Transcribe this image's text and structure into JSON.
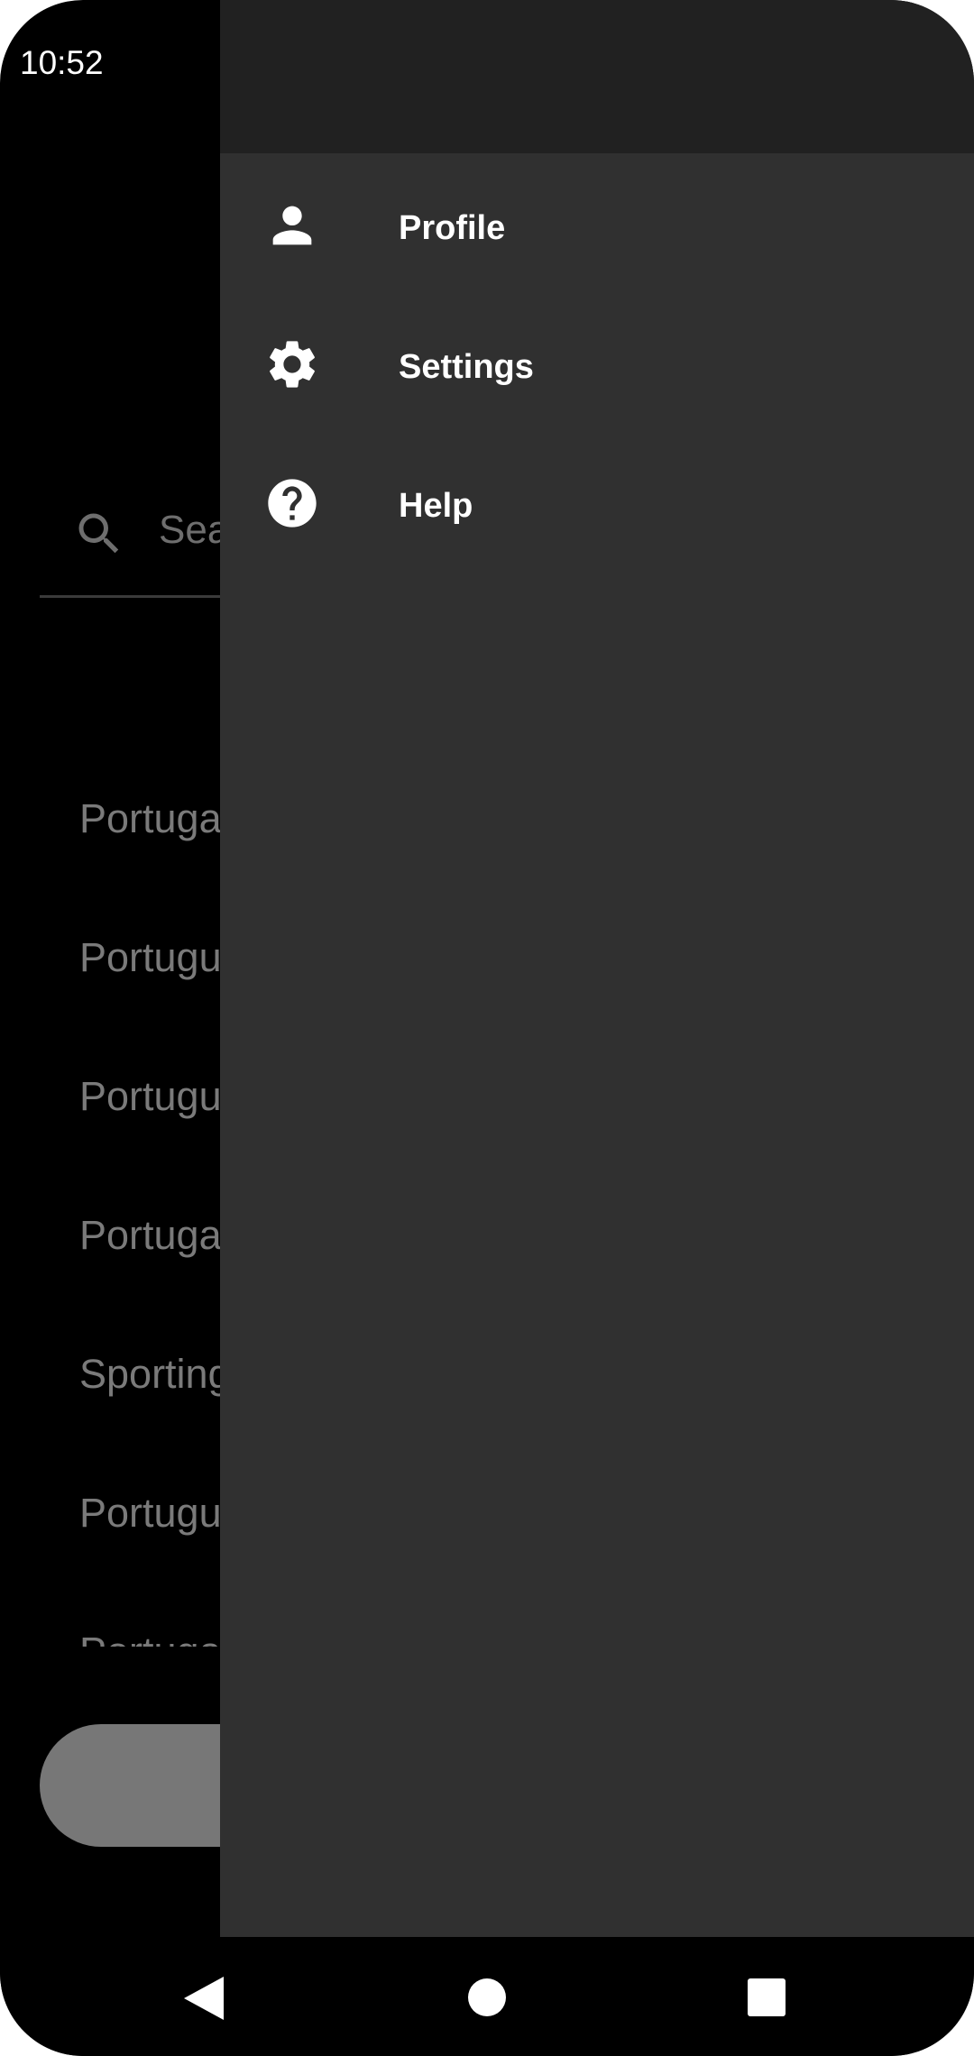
{
  "status_bar": {
    "time": "10:52"
  },
  "background": {
    "search": {
      "placeholder": "Search"
    },
    "list": [
      "Portugal",
      "Português",
      "Português",
      "Portugal",
      "Sporting",
      "Português",
      "Portugal"
    ],
    "colors": {
      "text": "#7a7a7a",
      "button": "#777777"
    }
  },
  "drawer": {
    "items": [
      {
        "label": "Profile",
        "icon": "person-icon"
      },
      {
        "label": "Settings",
        "icon": "gear-icon"
      },
      {
        "label": "Help",
        "icon": "help-icon"
      }
    ],
    "colors": {
      "background": "#303030",
      "header": "#212121",
      "text": "#ffffff"
    }
  },
  "nav_bar": {
    "buttons": [
      "back-icon",
      "home-icon",
      "recents-icon"
    ]
  }
}
